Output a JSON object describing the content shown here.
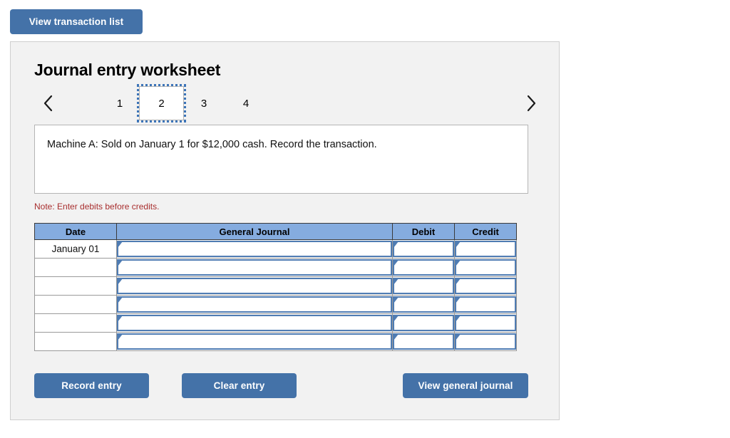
{
  "toolbar": {
    "view_transaction_list_label": "View transaction list"
  },
  "worksheet": {
    "title": "Journal entry worksheet",
    "pager": {
      "prev_icon": "chevron-left-icon",
      "next_icon": "chevron-right-icon",
      "tabs": [
        "1",
        "2",
        "3",
        "4"
      ],
      "active_tab": "2"
    },
    "description": "Machine A: Sold on January 1 for $12,000 cash. Record the transaction.",
    "note": "Note: Enter debits before credits.",
    "table": {
      "headers": [
        "Date",
        "General Journal",
        "Debit",
        "Credit"
      ],
      "rows": [
        {
          "date": "January 01",
          "general_journal": "",
          "debit": "",
          "credit": ""
        },
        {
          "date": "",
          "general_journal": "",
          "debit": "",
          "credit": ""
        },
        {
          "date": "",
          "general_journal": "",
          "debit": "",
          "credit": ""
        },
        {
          "date": "",
          "general_journal": "",
          "debit": "",
          "credit": ""
        },
        {
          "date": "",
          "general_journal": "",
          "debit": "",
          "credit": ""
        },
        {
          "date": "",
          "general_journal": "",
          "debit": "",
          "credit": ""
        }
      ]
    },
    "actions": {
      "record_entry_label": "Record entry",
      "clear_entry_label": "Clear entry",
      "view_general_journal_label": "View general journal"
    }
  },
  "colors": {
    "button_blue": "#4472a8",
    "header_blue": "#85ACDF",
    "field_border_blue": "#4f7cb3",
    "note_red": "#a82e2e",
    "panel_gray": "#f2f2f2"
  }
}
